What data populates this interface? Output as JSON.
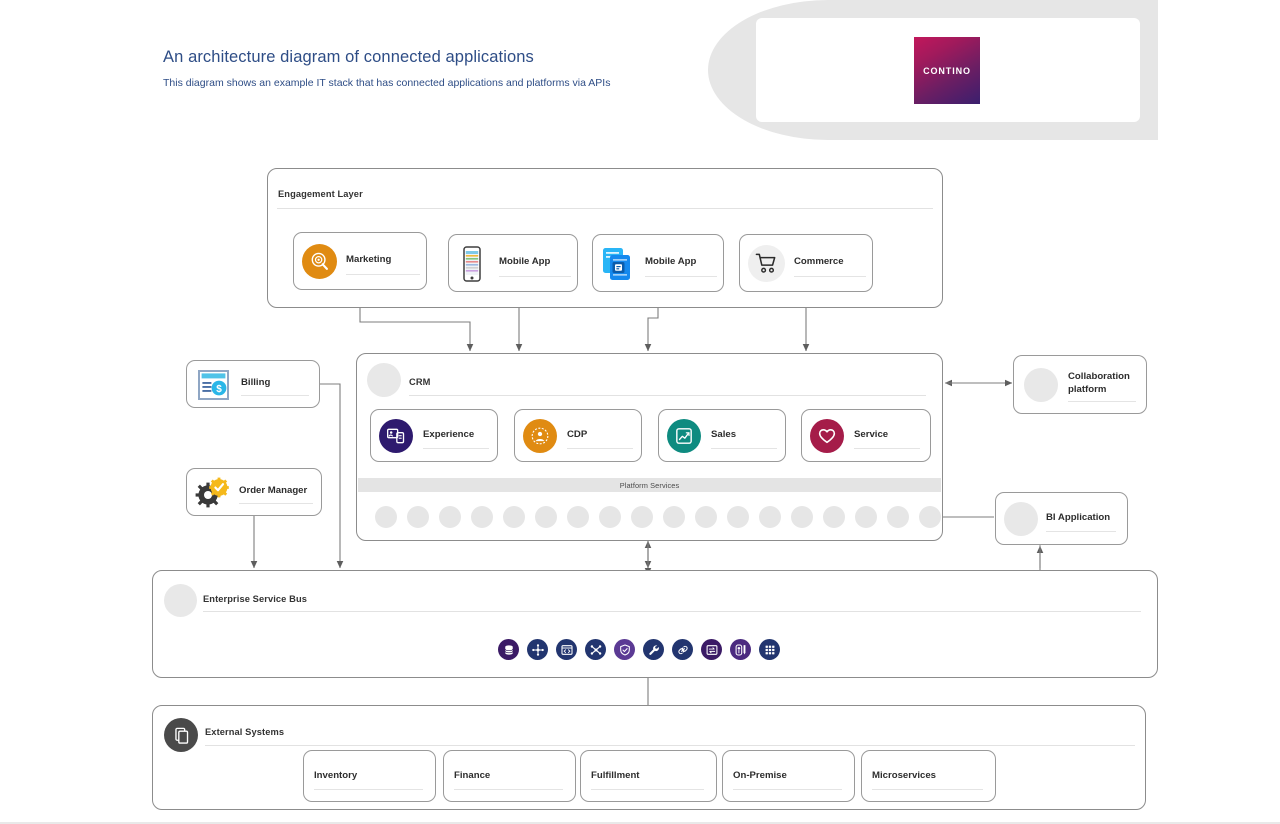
{
  "header": {
    "title": "An architecture diagram of connected applications",
    "subtitle": "This diagram shows an example IT stack that has connected applications and platforms via  APIs",
    "logo_text": "CONTINO",
    "logo_gradient_from": "#c2175b",
    "logo_gradient_to": "#3a1f6e",
    "title_color": "#2e4d86",
    "banner_color": "#e6e6e6"
  },
  "engagement_layer": {
    "title": "Engagement Layer",
    "cards": [
      {
        "label": "Marketing",
        "icon": "marketing-target-icon",
        "icon_color": "#e08b12"
      },
      {
        "label": "Mobile App",
        "icon": "mobile-phone-icon",
        "icon_color": "#3f3f3f"
      },
      {
        "label": "Mobile App",
        "icon": "blue-documents-icon",
        "icon_color": "#1589ee"
      },
      {
        "label": "Commerce",
        "icon": "shopping-cart-icon",
        "icon_color": "#efefef"
      }
    ]
  },
  "crm": {
    "title": "CRM",
    "cards": [
      {
        "label": "Experience",
        "icon": "experience-screen-icon",
        "icon_color": "#2e1a6e"
      },
      {
        "label": "CDP",
        "icon": "cdp-person-icon",
        "icon_color": "#e08b12"
      },
      {
        "label": "Sales",
        "icon": "sales-chart-icon",
        "icon_color": "#0e8b80"
      },
      {
        "label": "Service",
        "icon": "service-heart-icon",
        "icon_color": "#a51c49"
      }
    ],
    "platform_services": {
      "label": "Platform Services",
      "dot_count": 18,
      "dot_color": "#e6e6e6",
      "bar_color": "#e4e4e4"
    }
  },
  "left_nodes": [
    {
      "label": "Billing",
      "icon": "invoice-dollar-icon"
    },
    {
      "label": "Order Manager",
      "icon": "gears-check-icon"
    }
  ],
  "right_nodes": [
    {
      "label": "Collaboration platform",
      "label_line1": "Collaboration",
      "label_line2": "platform",
      "icon": "grey-circle-icon"
    },
    {
      "label": "BI Application",
      "icon": "grey-circle-icon"
    }
  ],
  "service_bus": {
    "title": "Enterprise Service Bus",
    "icons": [
      {
        "name": "database-icon",
        "color": "#3b1a66"
      },
      {
        "name": "network-hub-icon",
        "color": "#22356f"
      },
      {
        "name": "code-window-icon",
        "color": "#22356f"
      },
      {
        "name": "connector-tool-icon",
        "color": "#22356f"
      },
      {
        "name": "shield-check-icon",
        "color": "#5b3a94"
      },
      {
        "name": "wrench-icon",
        "color": "#22356f"
      },
      {
        "name": "link-chain-icon",
        "color": "#22356f"
      },
      {
        "name": "transfer-window-icon",
        "color": "#3b1a66"
      },
      {
        "name": "device-pen-icon",
        "color": "#4b2a80"
      },
      {
        "name": "grid-apps-icon",
        "color": "#22356f"
      }
    ]
  },
  "external_systems": {
    "title": "External Systems",
    "icon": "stacked-files-icon",
    "cards": [
      {
        "label": "Inventory"
      },
      {
        "label": "Finance"
      },
      {
        "label": "Fulfillment"
      },
      {
        "label": "On-Premise"
      },
      {
        "label": "Microservices"
      }
    ]
  }
}
